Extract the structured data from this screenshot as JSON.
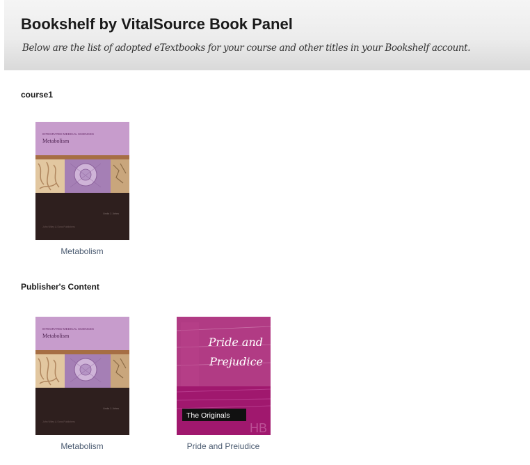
{
  "header": {
    "title": "Bookshelf by VitalSource Book Panel",
    "subtitle": "Below are the list of adopted eTextbooks for your course and other titles in your Bookshelf account."
  },
  "sections": [
    {
      "heading": "course1",
      "books": [
        {
          "title": "Metabolism",
          "cover_series": "INTEGRATED MEDICAL SCIENCES",
          "cover_title": "Metabolism",
          "cover_author": "Linda J. Johns",
          "cover_publisher": "John Wiley & Sons Publishers"
        }
      ]
    },
    {
      "heading": "Publisher's Content",
      "books": [
        {
          "title": "Metabolism",
          "cover_series": "INTEGRATED MEDICAL SCIENCES",
          "cover_title": "Metabolism",
          "cover_author": "Linda J. Johns",
          "cover_publisher": "John Wiley & Sons Publishers"
        },
        {
          "title": "Pride and Preiudice",
          "cover_title_line1": "Pride and",
          "cover_title_line2": "Prejudice",
          "cover_banner": "The Originals",
          "cover_mark": "HB"
        }
      ]
    }
  ],
  "colors": {
    "header_gradient_top": "#f5f5f5",
    "header_gradient_bottom": "#d9d9d9",
    "link_text": "#4a5a70",
    "metabolism_cover_top": "#c79ccc",
    "metabolism_cover_bottom": "#2e1f1e",
    "pride_cover": "#a0186e"
  }
}
